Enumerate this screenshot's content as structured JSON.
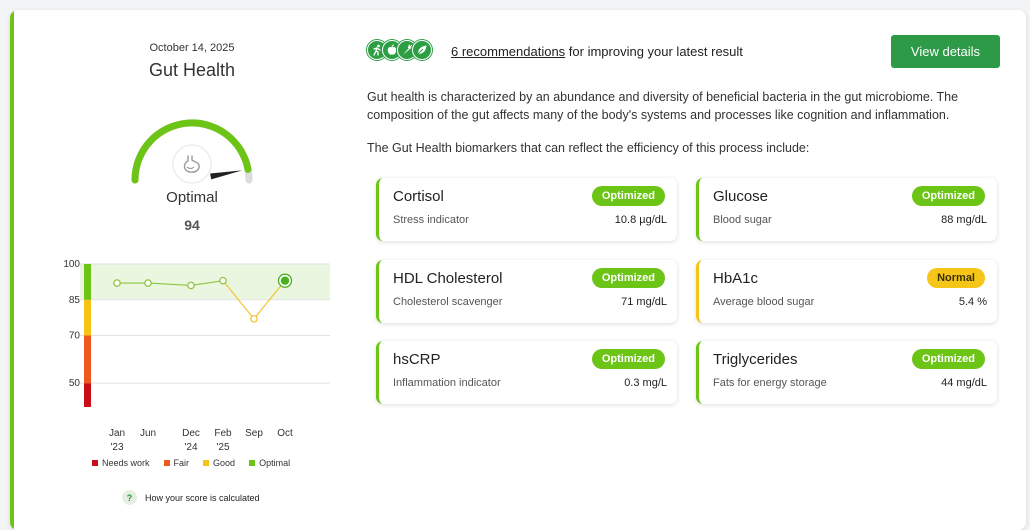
{
  "left": {
    "date": "October 14, 2025",
    "title": "Gut Health",
    "status": "Optimal",
    "score": "94",
    "gauge": {
      "value": 94,
      "max": 100
    },
    "help_text": "How your score is calculated",
    "help_icon": "question-mark-icon",
    "legend": [
      {
        "label": "Needs work",
        "color": "#c80f19"
      },
      {
        "label": "Fair",
        "color": "#f0591e"
      },
      {
        "label": "Good",
        "color": "#f7c315"
      },
      {
        "label": "Optimal",
        "color": "#6cc417"
      }
    ]
  },
  "chart_data": {
    "type": "line",
    "ylim": [
      40,
      100
    ],
    "y_ticks": [
      "100",
      "85",
      "70",
      "50"
    ],
    "x_tick_labels": [
      {
        "month": "Jan",
        "year": "'23"
      },
      {
        "month": "Jun",
        "year": ""
      },
      {
        "month": "Dec",
        "year": "'24"
      },
      {
        "month": "Feb",
        "year": "'25"
      },
      {
        "month": "Sep",
        "year": ""
      },
      {
        "month": "Oct",
        "year": ""
      }
    ],
    "values": [
      92,
      92,
      91,
      93,
      77,
      93
    ],
    "optimal_band": [
      85,
      100
    ],
    "colors": {
      "line": "#8cc63f",
      "low_segment": "#f3c535",
      "band": "#eaf6e0",
      "point_fill": "#ffffff"
    }
  },
  "right": {
    "reco_icons": [
      "running-icon",
      "apple-icon",
      "carrot-icon",
      "leaf-icon"
    ],
    "reco_link": "6 recommendations",
    "reco_rest": " for improving your latest result",
    "view_button": "View details",
    "description": "Gut health is characterized by an abundance and diversity of beneficial bacteria in the gut microbiome. The composition of the gut affects many of the body's systems and processes like cognition and inflammation.",
    "intro": "The Gut Health biomarkers that can reflect the efficiency of this process include:",
    "biomarkers": [
      {
        "name": "Cortisol",
        "badge": "Optimized",
        "sub": "Stress indicator",
        "value": "10.8 µg/dL"
      },
      {
        "name": "Glucose",
        "badge": "Optimized",
        "sub": "Blood sugar",
        "value": "88 mg/dL"
      },
      {
        "name": "HDL Cholesterol",
        "badge": "Optimized",
        "sub": "Cholesterol scavenger",
        "value": "71 mg/dL"
      },
      {
        "name": "HbA1c",
        "badge": "Normal",
        "sub": "Average blood sugar",
        "value": "5.4 %"
      },
      {
        "name": "hsCRP",
        "badge": "Optimized",
        "sub": "Inflammation indicator",
        "value": "0.3 mg/L"
      },
      {
        "name": "Triglycerides",
        "badge": "Optimized",
        "sub": "Fats for energy storage",
        "value": "44 mg/dL"
      }
    ],
    "accent_optimized": "#6cc417",
    "accent_normal": "#f5c518"
  }
}
